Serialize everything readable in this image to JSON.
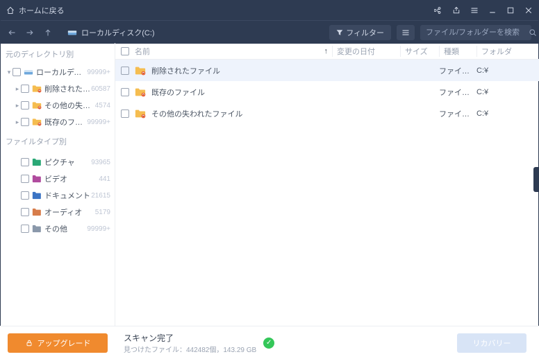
{
  "titlebar": {
    "home_label": "ホームに戻る"
  },
  "toolbar": {
    "path_label": "ローカルディスク(C:)",
    "filter_label": "フィルター",
    "search_placeholder": "ファイル/フォルダーを検索"
  },
  "sidebar": {
    "dir_section": "元のディレクトリ別",
    "type_section": "ファイルタイプ別",
    "tree": [
      {
        "label": "ローカルディスク(C:)",
        "count": "99999+"
      },
      {
        "label": "削除されたファイル",
        "count": "60587"
      },
      {
        "label": "その他の失われたファイル",
        "count": "4574"
      },
      {
        "label": "既存のファイル",
        "count": "99999+"
      }
    ],
    "types": [
      {
        "label": "ピクチャ",
        "count": "93965",
        "color": "#2aa876"
      },
      {
        "label": "ビデオ",
        "count": "441",
        "color": "#b04b9e"
      },
      {
        "label": "ドキュメント",
        "count": "21615",
        "color": "#3b74c4"
      },
      {
        "label": "オーディオ",
        "count": "5179",
        "color": "#d77c4a"
      },
      {
        "label": "その他",
        "count": "99999+",
        "color": "#8a98aa"
      }
    ]
  },
  "columns": {
    "name": "名前",
    "date": "変更の日付",
    "size": "サイズ",
    "type": "種類",
    "folder": "フォルダ"
  },
  "rows": [
    {
      "name": "削除されたファイル",
      "type": "ファイル フ…",
      "folder": "C:¥",
      "selected": true
    },
    {
      "name": "既存のファイル",
      "type": "ファイル フ…",
      "folder": "C:¥",
      "selected": false
    },
    {
      "name": "その他の失われたファイル",
      "type": "ファイル フ…",
      "folder": "C:¥",
      "selected": false
    }
  ],
  "footer": {
    "upgrade": "アップグレード",
    "status_title": "スキャン完了",
    "status_sub": "見つけたファイル：442482個，143.29 GB",
    "recover": "リカバリー"
  }
}
